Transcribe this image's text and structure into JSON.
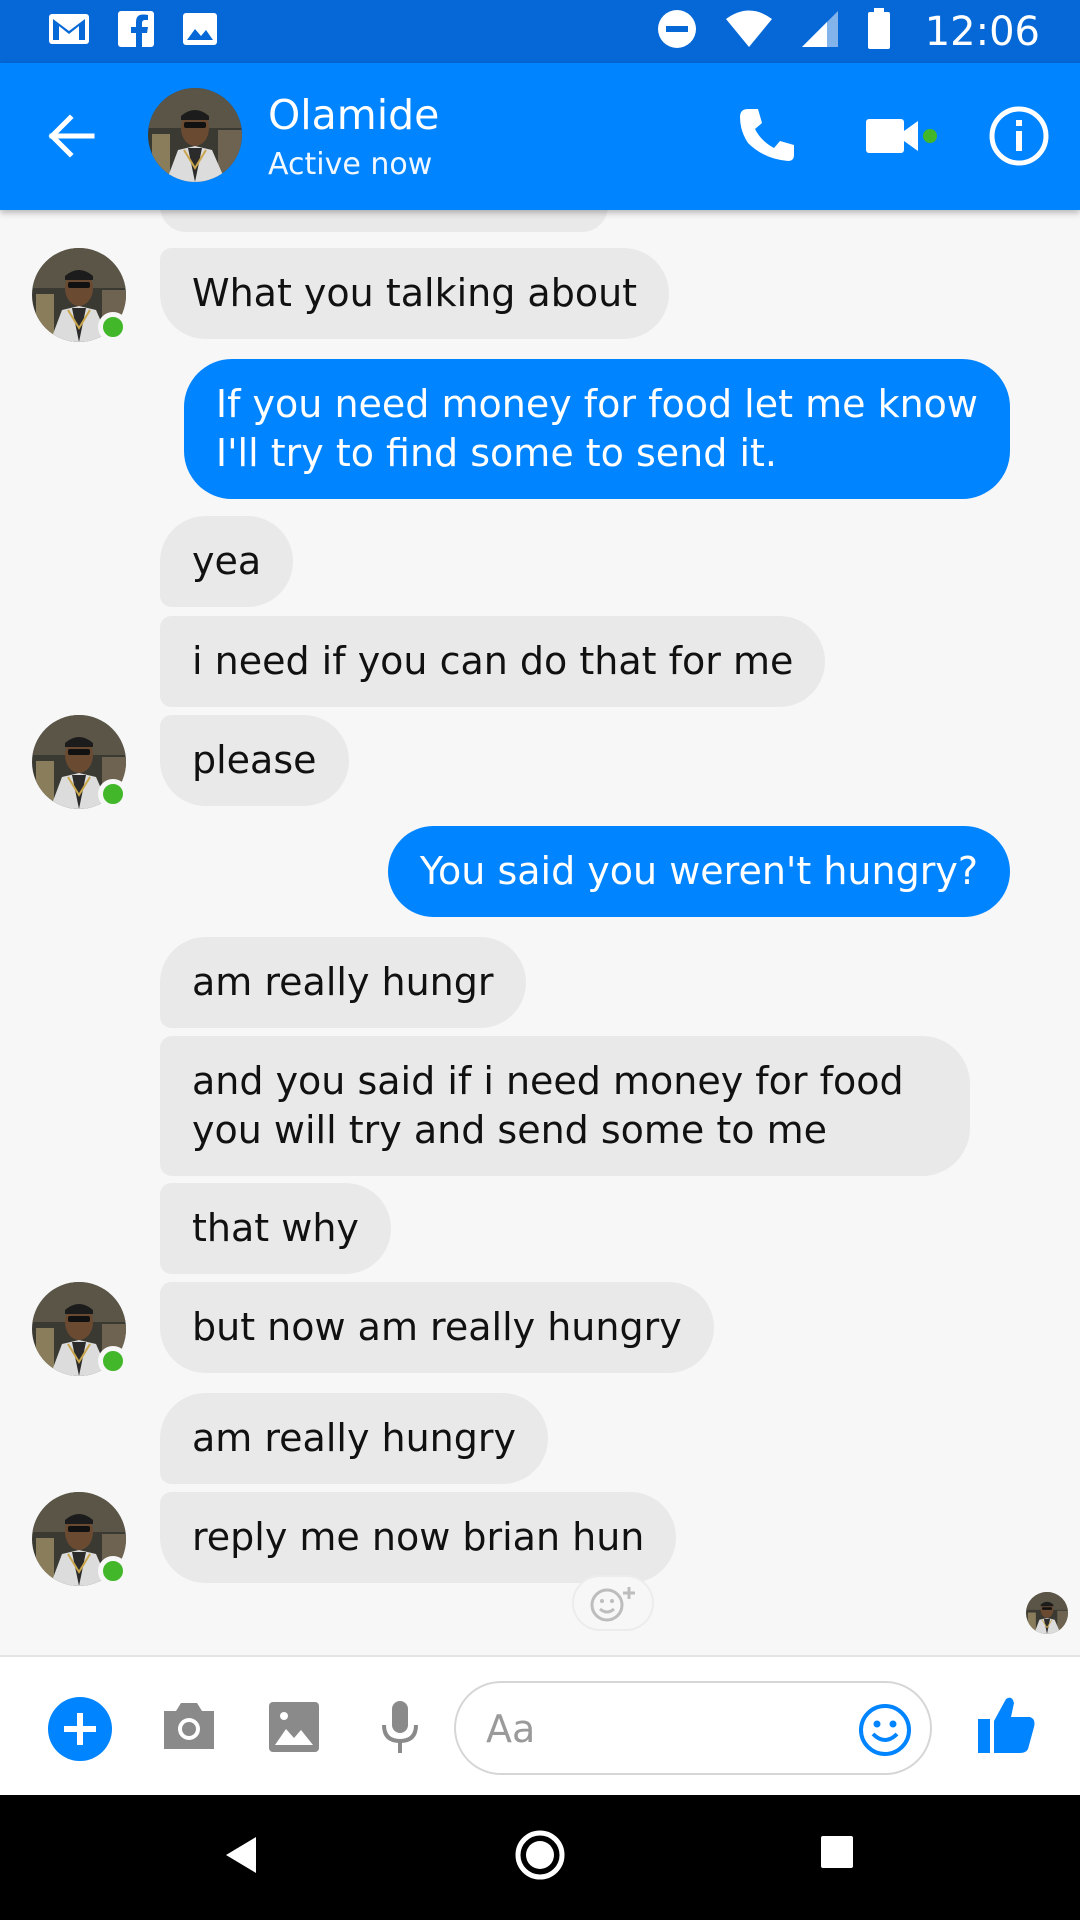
{
  "status_bar": {
    "time": "12:06",
    "left_icons": [
      "gmail-icon",
      "facebook-icon",
      "image-notification-icon"
    ],
    "right_icons": [
      "do-not-disturb-icon",
      "wifi-icon",
      "signal-icon",
      "battery-icon"
    ]
  },
  "header": {
    "name": "Olamide",
    "status": "Active now",
    "icons": [
      "back-arrow-icon",
      "phone-icon",
      "video-camera-icon",
      "info-icon"
    ],
    "accent_color": "#0084ff",
    "status_bar_color": "#0568d6"
  },
  "messages": [
    {
      "sender": "them",
      "text": "What you talking about"
    },
    {
      "sender": "me",
      "line1": "If you need money for food let me know",
      "line2": "I'll try to find some to send it."
    },
    {
      "sender": "them",
      "text": "yea"
    },
    {
      "sender": "them",
      "text": "i need if you can do that for me"
    },
    {
      "sender": "them",
      "text": "please"
    },
    {
      "sender": "me",
      "text": "You said you weren't hungry?"
    },
    {
      "sender": "them",
      "text": "am really hungr"
    },
    {
      "sender": "them",
      "line1": "and you said if i need money for food",
      "line2": "you will try and send some to me"
    },
    {
      "sender": "them",
      "text": "that why"
    },
    {
      "sender": "them",
      "text": "but now am really hungry"
    },
    {
      "sender": "them",
      "text": "am really hungry"
    },
    {
      "sender": "them",
      "text": "reply me now brian hun"
    }
  ],
  "composer": {
    "placeholder": "Aa",
    "icons": [
      "plus-icon",
      "camera-icon",
      "gallery-icon",
      "microphone-icon",
      "emoji-icon",
      "thumbs-up-icon"
    ]
  },
  "nav_bar": {
    "icons": [
      "back-triangle-icon",
      "home-circle-icon",
      "recents-square-icon"
    ]
  },
  "colors": {
    "incoming_bubble": "#e9e9ea",
    "outgoing_bubble": "#0084ff",
    "online_dot": "#42b72a"
  }
}
